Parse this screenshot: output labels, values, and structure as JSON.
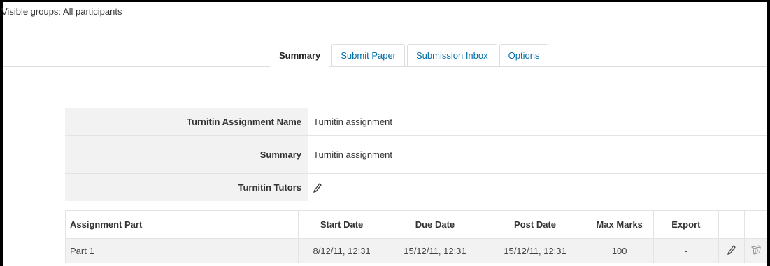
{
  "groups": {
    "text": "Visible groups: All participants"
  },
  "tabs": [
    {
      "label": "Summary",
      "active": true
    },
    {
      "label": "Submit Paper",
      "active": false
    },
    {
      "label": "Submission Inbox",
      "active": false
    },
    {
      "label": "Options",
      "active": false
    }
  ],
  "summary": {
    "name_label": "Turnitin Assignment Name",
    "name_value": "Turnitin assignment",
    "summary_label": "Summary",
    "summary_value": "Turnitin assignment",
    "tutors_label": "Turnitin Tutors",
    "tutors_icon": "pencil-icon"
  },
  "parts_table": {
    "headers": [
      "Assignment Part",
      "Start Date",
      "Due Date",
      "Post Date",
      "Max Marks",
      "Export",
      "",
      ""
    ],
    "rows": [
      {
        "part": "Part 1",
        "start": "8/12/11, 12:31",
        "due": "15/12/11, 12:31",
        "post": "15/12/11, 12:31",
        "max_marks": "100",
        "export": "-",
        "edit_icon": "pencil-icon",
        "delete_icon": "bin-icon"
      }
    ]
  },
  "colors": {
    "link": "#0070a8",
    "row_bg": "#f2f2f2",
    "border": "#e3e3e3"
  }
}
